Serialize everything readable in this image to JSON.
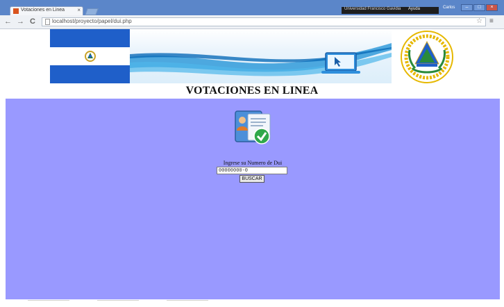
{
  "browser": {
    "tab_title": "Votaciones en Linea",
    "tab_close": "×",
    "system_label": "Universidad Francisco Gavidia",
    "help_label": "Ayuda",
    "user_label": "Carlos",
    "window_buttons": [
      "–",
      "□",
      "×"
    ],
    "nav_back": "←",
    "nav_forward": "→",
    "nav_reload": "C",
    "url": "localhost/proyecto/papel/dui.php",
    "star_icon": "☆",
    "menu_icon": "≡"
  },
  "banner": {
    "heading": "VOTACIONES EN LINEA",
    "flag_colors": {
      "blue": "#1f5fc9",
      "white": "#ffffff"
    }
  },
  "form": {
    "label": "Ingrese su Numero de Dui",
    "dui_value": "00000000-0",
    "submit_label": "BUSCAR"
  },
  "colors": {
    "page_background": "#9999ff",
    "titlebar": "#5b86c9"
  }
}
